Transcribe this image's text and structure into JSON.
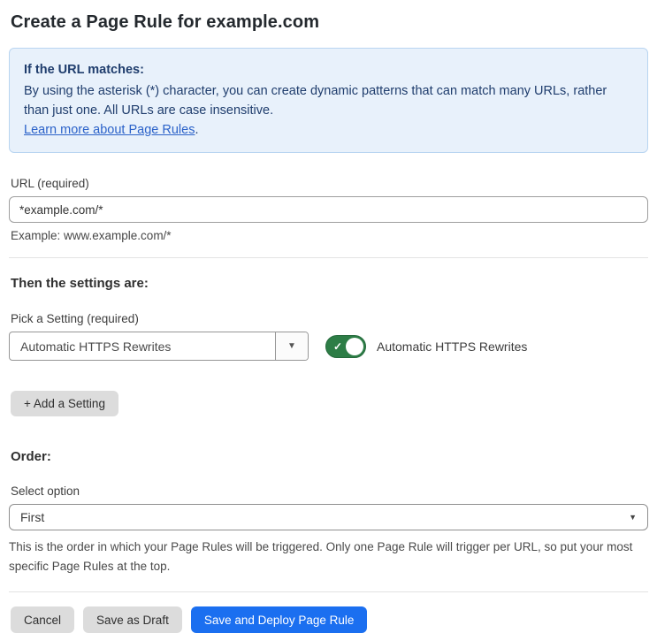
{
  "page": {
    "title": "Create a Page Rule for example.com"
  },
  "info_box": {
    "heading": "If the URL matches:",
    "body": "By using the asterisk (*) character, you can create dynamic patterns that can match many URLs, rather than just one. All URLs are case insensitive.",
    "link_label": "Learn more about Page Rules",
    "link_suffix": "."
  },
  "url_field": {
    "label": "URL (required)",
    "value": "*example.com/*",
    "helper": "Example: www.example.com/*"
  },
  "settings_section": {
    "heading": "Then the settings are:",
    "picker_label": "Pick a Setting (required)",
    "picker_value": "Automatic HTTPS Rewrites",
    "picker_arrow_icon": "▼",
    "toggle_state": "on",
    "toggle_check_icon": "✓",
    "toggle_label": "Automatic HTTPS Rewrites",
    "add_setting_label": "+ Add a Setting"
  },
  "order_section": {
    "heading": "Order:",
    "select_label": "Select option",
    "select_value": "First",
    "select_arrow_icon": "▼",
    "helper": "This is the order in which your Page Rules will be triggered. Only one Page Rule will trigger per URL, so put your most specific Page Rules at the top."
  },
  "footer": {
    "cancel_label": "Cancel",
    "save_draft_label": "Save as Draft",
    "save_deploy_label": "Save and Deploy Page Rule"
  },
  "colors": {
    "accent_blue": "#1b6ff0",
    "info_background": "#e8f1fb",
    "info_border": "#b9d5f1",
    "info_text": "#1f3d6d",
    "link_blue": "#2b62c9",
    "toggle_green": "#2d7d46",
    "button_gray": "#dcdcdc"
  }
}
